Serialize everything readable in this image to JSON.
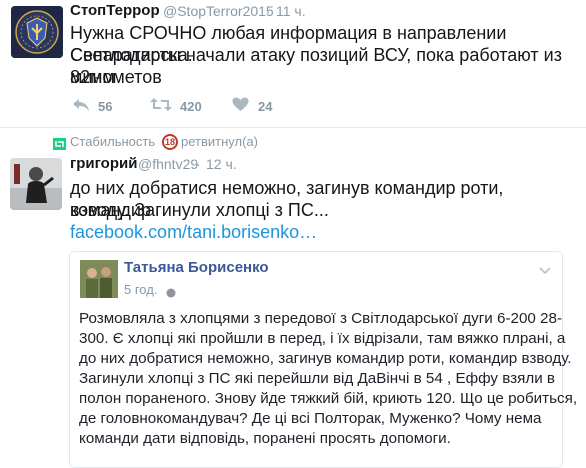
{
  "tweet1": {
    "author_name": "СтопТеррор",
    "handle": "@StopTerror2015",
    "time": "11 ч.",
    "text_lines": [
      "Нужна СРОЧНО любая информация в направлении Светлодарска.",
      "Сепаратисты начали атаку позиций ВСУ, пока работают из 82мм",
      "минометов"
    ],
    "actions": {
      "reply_icon": "reply-icon",
      "retweet_icon": "retweet-icon",
      "like_icon": "heart-icon",
      "reply_count": "56",
      "retweet_count": "420",
      "like_count": "24"
    }
  },
  "retweet_context": {
    "user": "Стабильность",
    "badge": "18",
    "action_text": "ретвитнул(а)"
  },
  "tweet2": {
    "author_name": "григорий",
    "handle": "@fhntv29",
    "time": "12 ч.",
    "text_lines": [
      "до них добратися неможно, загинув командир роти, командир",
      "взводу. Загинули хлопці з ПС..."
    ],
    "link": "facebook.com/tani.borisenko…"
  },
  "card": {
    "name": "Татьяна Борисенко",
    "time": "5 год.",
    "text_lines": [
      "Розмовляла з хлопцями з передової з Світлодарської дуги 6-200 28-",
      "300. Є хлопці які пройшли в перед, і їх відрізали, там вяжко плрані, а",
      "до них добратися неможно, загинув командир роти, командир взводу.",
      "Загинули хлопці з ПС які перейшли від ДаВінчі в 54 , Еффу взяли в",
      "полон пораненого. Знову йде тяжкий бій, криють 120. Що це робиться,",
      "де головнокомандувач? Де ці всі Полторак, Муженко? Чому нема",
      "команди дати відповідь, поранені просять допомоги."
    ]
  },
  "colors": {
    "brand_green": "#19cf86",
    "link_blue": "#1b95e0",
    "meta_gray": "#8899a6",
    "badge_red": "#c0392b"
  }
}
